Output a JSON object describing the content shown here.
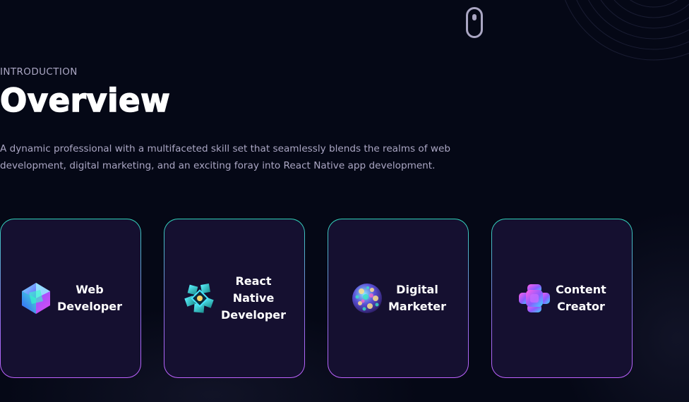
{
  "section": {
    "subtitle": "INTRODUCTION",
    "title": "Overview",
    "description": "A dynamic professional with a multifaceted skill set that seamlessly blends the realms of web development, digital marketing, and an exciting foray into React Native app development."
  },
  "services": [
    {
      "label": "Web\nDeveloper",
      "icon": "web-icon"
    },
    {
      "label": "React\nNative\nDeveloper",
      "icon": "react-native-icon"
    },
    {
      "label": "Digital\nMarketer",
      "icon": "digital-marketing-icon"
    },
    {
      "label": "Content\nCreator",
      "icon": "content-creator-icon"
    }
  ],
  "colors": {
    "background": "#050816",
    "card": "#151030",
    "secondary_text": "#aaa6c3",
    "border_top": "#2fd3b9",
    "border_bottom": "#bf61ff"
  }
}
